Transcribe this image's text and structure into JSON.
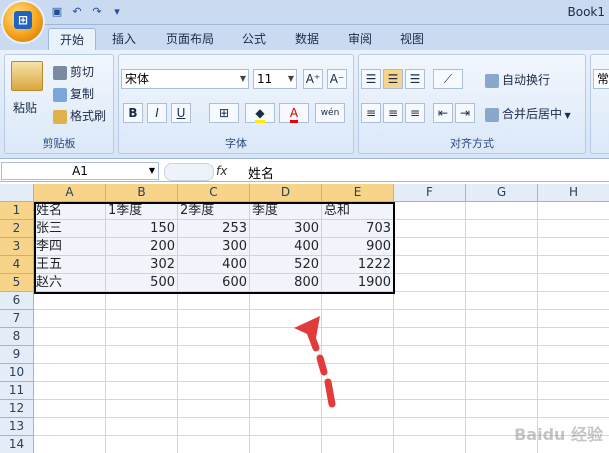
{
  "app": {
    "title": "Book1"
  },
  "tabs": [
    "开始",
    "插入",
    "页面布局",
    "公式",
    "数据",
    "审阅",
    "视图"
  ],
  "clipboard": {
    "paste": "粘贴",
    "cut": "剪切",
    "copy": "复制",
    "format_painter": "格式刷",
    "label": "剪贴板"
  },
  "font": {
    "name": "宋体",
    "size": "11",
    "grow": "A⁺",
    "shrink": "A⁻",
    "bold": "B",
    "italic": "I",
    "underline": "U",
    "wen": "wén",
    "label": "字体"
  },
  "align": {
    "wrap": "自动换行",
    "merge": "合并后居中",
    "label": "对齐方式"
  },
  "number": {
    "format": "常规"
  },
  "formula_bar": {
    "cell_ref": "A1",
    "fx": "fx",
    "value": "姓名"
  },
  "columns": [
    "A",
    "B",
    "C",
    "D",
    "E",
    "F",
    "G",
    "H"
  ],
  "rows": [
    "1",
    "2",
    "3",
    "4",
    "5",
    "6",
    "7",
    "8",
    "9",
    "10",
    "11",
    "12",
    "13",
    "14"
  ],
  "table": [
    [
      "姓名",
      "1季度",
      "2季度",
      "季度",
      "总和"
    ],
    [
      "张三",
      "150",
      "253",
      "300",
      "703"
    ],
    [
      "李四",
      "200",
      "300",
      "400",
      "900"
    ],
    [
      "王五",
      "302",
      "400",
      "520",
      "1222"
    ],
    [
      "赵六",
      "500",
      "600",
      "800",
      "1900"
    ]
  ],
  "watermark": "Baidu 经验",
  "colors": {
    "accent": "#f8d48a",
    "ribbon": "#dbe8f8",
    "arrow": "#e23b3b"
  }
}
